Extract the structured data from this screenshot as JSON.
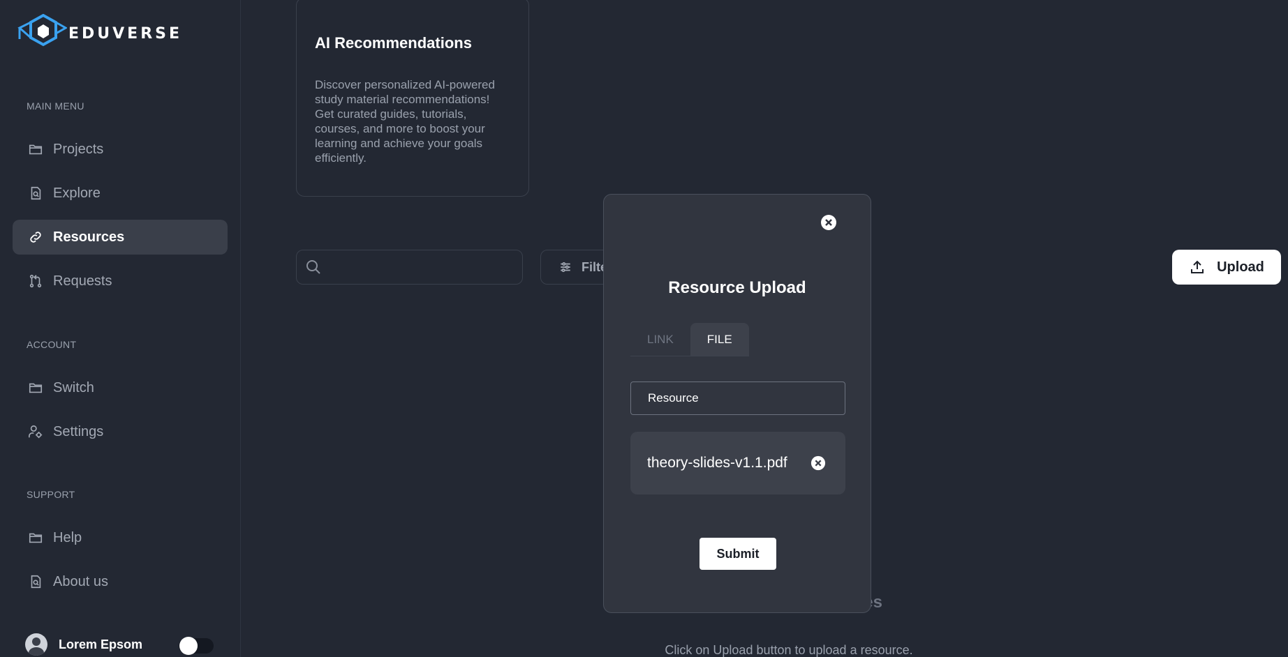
{
  "brand": {
    "name": "EDUVERSE",
    "accent": "#3aa2f0"
  },
  "sidebar": {
    "main_menu_label": "MAIN MENU",
    "main_items": [
      {
        "label": "Projects",
        "icon": "folder-icon"
      },
      {
        "label": "Explore",
        "icon": "file-search-icon"
      },
      {
        "label": "Resources",
        "icon": "link-icon",
        "active": true
      },
      {
        "label": "Requests",
        "icon": "git-pull-request-icon"
      }
    ],
    "account_label": "ACCOUNT",
    "account_items": [
      {
        "label": "Switch",
        "icon": "folder-icon"
      },
      {
        "label": "Settings",
        "icon": "user-cog-icon"
      }
    ],
    "support_label": "SUPPORT",
    "support_items": [
      {
        "label": "Help",
        "icon": "folder-icon"
      },
      {
        "label": "About us",
        "icon": "file-search-icon"
      }
    ],
    "user": {
      "name": "Lorem Epsom"
    }
  },
  "main": {
    "ai_card": {
      "title": "AI Recommendations",
      "description": "Discover personalized AI-powered study material recommendations! Get curated guides, tutorials, courses, and more to boost your learning and achieve your goals efficiently."
    },
    "search": {
      "placeholder": ""
    },
    "filter_label": "Filte",
    "upload_label": "Upload",
    "empty_title": "es",
    "empty_subtitle": "Click on Upload button to upload a resource."
  },
  "modal": {
    "title": "Resource Upload",
    "tabs": [
      {
        "label": "LINK"
      },
      {
        "label": "FILE",
        "active": true
      }
    ],
    "name_value": "Resource",
    "file_name": "theory-slides-v1.1.pdf",
    "submit_label": "Submit"
  }
}
